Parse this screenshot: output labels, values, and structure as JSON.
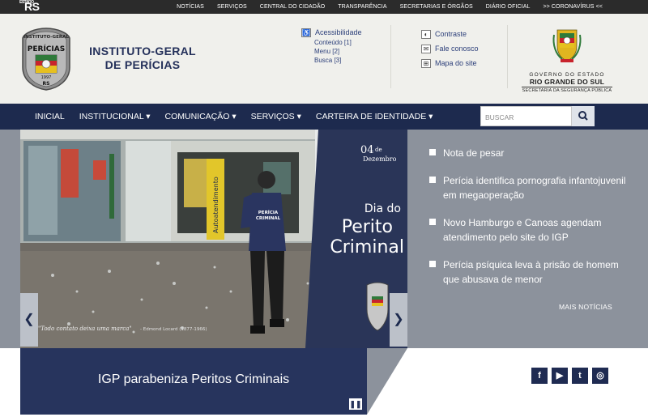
{
  "topbar": {
    "logo_prefix": "ESTADO",
    "logo": "RS",
    "links": [
      "NOTÍCIAS",
      "SERVIÇOS",
      "CENTRAL DO CIDADÃO",
      "TRANSPARÊNCIA",
      "SECRETARIAS E ÓRGÃOS",
      "DIÁRIO OFICIAL",
      ">> CORONAVÍRUS <<"
    ]
  },
  "header": {
    "title_line1": "INSTITUTO-GERAL",
    "title_line2": "DE PERÍCIAS",
    "badge_text_top": "INSTITUTO-GERAL",
    "badge_text_mid": "PERÍCIAS",
    "badge_year": "1997",
    "badge_rs": "RS",
    "accessibility": {
      "label": "Acessibilidade",
      "items": [
        "Conteúdo [1]",
        "Menu [2]",
        "Busca [3]"
      ]
    },
    "options": [
      "Contraste",
      "Fale conosco",
      "Mapa do site"
    ],
    "gov": {
      "line1": "GOVERNO DO ESTADO",
      "line2": "RIO GRANDE DO SUL",
      "line3": "SECRETARIA DA SEGURANÇA PÚBLICA"
    }
  },
  "nav": {
    "items": [
      "INICIAL",
      "INSTITUCIONAL ▾",
      "COMUNICAÇÃO ▾",
      "SERVIÇOS ▾",
      "CARTEIRA DE IDENTIDADE ▾"
    ],
    "search_placeholder": "BUSCAR"
  },
  "slide": {
    "date_day": "04",
    "date_de": "de",
    "date_month": "Dezembro",
    "headline_small": "Dia do",
    "headline_big1": "Perito",
    "headline_big2": "Criminal",
    "quote": "\"Todo contato deixa uma marca\"",
    "quote_author": "- Edmond Locard (1877-1966)",
    "shirt_text1": "PERÍCIA",
    "shirt_text2": "CRIMINAL",
    "sign_text": "Autoatendimento"
  },
  "news": {
    "items": [
      "Nota de pesar",
      "Perícia identifica pornografia infantojuvenil em megaoperação",
      "Novo Hamburgo e Canoas agendam atendimento pelo site do IGP",
      "Perícia psíquica leva à prisão de homem que abusava de menor"
    ],
    "more": "MAIS NOTÍCIAS"
  },
  "banner": {
    "title": "IGP parabeniza Peritos Criminais",
    "pause_icon": "❚❚"
  },
  "social": {
    "facebook": "f",
    "youtube": "▶",
    "twitter": "t",
    "instagram": "◎"
  },
  "colors": {
    "navy": "#1d2a4e",
    "header_bg": "#f0f0ec",
    "panel_gray": "#8c929c",
    "link_blue": "#2c3f7a"
  }
}
